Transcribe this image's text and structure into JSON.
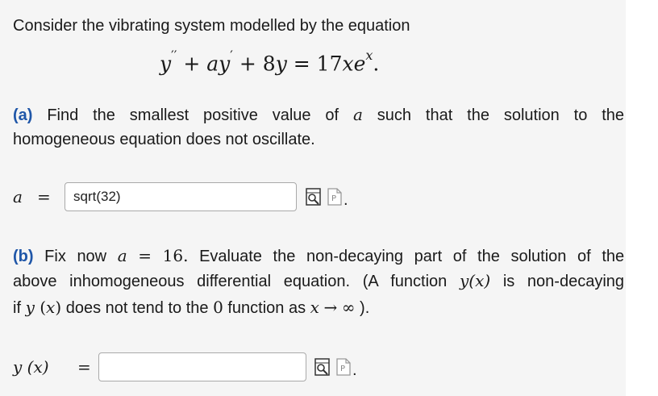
{
  "intro": {
    "text": "Consider the vibrating system modelled by the equation"
  },
  "equation": {
    "lhs_y": "y",
    "lhs_primes": "′′",
    "plus1": "+",
    "a": "a",
    "y2": "y",
    "prime": "′",
    "plus2": "+",
    "eight": "8",
    "y3": "y",
    "equals": "=",
    "seventeen": "17",
    "x": "x",
    "e": "e",
    "exp": "x",
    "period": "."
  },
  "part_a": {
    "label": "(a)",
    "line1_words": [
      "Find",
      "the",
      "smallest",
      "positive",
      "value",
      "of",
      "a",
      "such",
      "that",
      "the",
      "solution",
      "to",
      "the"
    ],
    "line2": "homogeneous equation does not oscillate.",
    "answer_var": "a",
    "answer_eq": "=",
    "answer_value": "sqrt(32)",
    "after_buttons": "."
  },
  "part_b": {
    "label": "(b)",
    "line1_words": [
      "Fix",
      "now",
      "a",
      "=",
      "16.",
      "Evaluate",
      "the",
      "non-decaying",
      "part",
      "of",
      "the",
      "solution",
      "of",
      "the"
    ],
    "line2_words": [
      "above",
      "inhomogeneous",
      "differential",
      "equation.",
      "(A",
      "function",
      "y(x)",
      "is",
      "non-decaying"
    ],
    "line3_pre": "if ",
    "line3_y": "y",
    "line3_x": "x",
    "line3_mid": " does not tend to the ",
    "line3_zero": "0",
    "line3_mid2": " function as ",
    "line3_var": "x",
    "line3_arrow": "→",
    "line3_inf": "∞",
    "line3_end": " ).",
    "answer_lhs": "y (x)",
    "answer_eq": "=",
    "answer_value": "",
    "after_buttons": "."
  },
  "icons": {
    "preview": "preview-icon",
    "help": "help-icon"
  }
}
